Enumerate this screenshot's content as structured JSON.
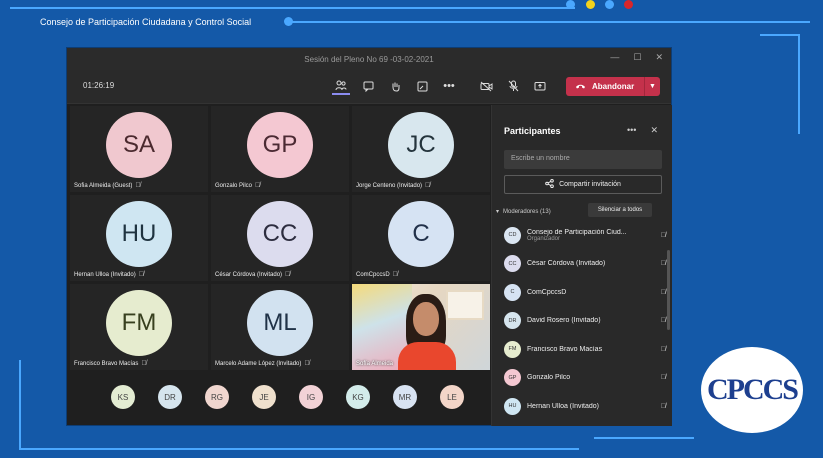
{
  "org_title": "Consejo de Participación Ciudadana y Control Social",
  "accent_colors": {
    "background": "#1459a8",
    "line": "#4aa8ff",
    "dot_yellow": "#f2d21c",
    "dot_red": "#d8262b",
    "dot_blue": "#4aa8ff",
    "leave": "#c4314b"
  },
  "window": {
    "title": "Sesión del Pleno No 69 -03-02-2021",
    "controls": [
      "—",
      "☐",
      "✕"
    ]
  },
  "toolbar": {
    "timer": "01:26:19",
    "leave_label": "Abandonar",
    "icons": [
      "participants-icon",
      "chat-icon",
      "raise-hand-icon",
      "share-tray-icon",
      "more-icon",
      "camera-off-icon",
      "mic-off-icon",
      "share-screen-icon"
    ]
  },
  "tiles": [
    {
      "initials": "SA",
      "name": "Sofia Almeida (Guest)",
      "color": "#f0c8cf"
    },
    {
      "initials": "GP",
      "name": "Gonzalo Pilco",
      "color": "#f4c8d2"
    },
    {
      "initials": "JC",
      "name": "Jorge Centeno (Invitado)",
      "color": "#d8e7ee"
    },
    {
      "initials": "HU",
      "name": "Hernan Ulloa (Invitado)",
      "color": "#cfe6f2"
    },
    {
      "initials": "CC",
      "name": "César Córdova (Invitado)",
      "color": "#dcdcee"
    },
    {
      "initials": "C",
      "name": "ComCpccsD",
      "color": "#d6e3f3"
    },
    {
      "initials": "FM",
      "name": "Francisco Bravo Macías",
      "color": "#e6eccf"
    },
    {
      "initials": "ML",
      "name": "Marcelo Adame López (Invitado)",
      "color": "#d2e2f0"
    },
    {
      "initials": "",
      "name": "Sofía Almeida",
      "color": ""
    }
  ],
  "strip": [
    {
      "initials": "KS",
      "color": "#e3ecd2"
    },
    {
      "initials": "DR",
      "color": "#d6e5ee"
    },
    {
      "initials": "RG",
      "color": "#f0d6cf"
    },
    {
      "initials": "JE",
      "color": "#efe0cd"
    },
    {
      "initials": "IG",
      "color": "#f2d2d6"
    },
    {
      "initials": "KG",
      "color": "#d3ecea"
    },
    {
      "initials": "MR",
      "color": "#d8e3f2"
    },
    {
      "initials": "LE",
      "color": "#f3d5c8"
    }
  ],
  "panel": {
    "title": "Participantes",
    "search_placeholder": "Escribe un nombre",
    "share_label": "Compartir invitación",
    "moderators_label": "Moderadores (13)",
    "mute_all_label": "Silenciar a todos",
    "participants": [
      {
        "initials": "CD",
        "name": "Consejo de Participación Ciud...",
        "role": "Organizador",
        "color": "#dbe6f2"
      },
      {
        "initials": "CC",
        "name": "César Córdova (Invitado)",
        "role": "",
        "color": "#dcdcee"
      },
      {
        "initials": "C",
        "name": "ComCpccsD",
        "role": "",
        "color": "#d6e3f3"
      },
      {
        "initials": "DR",
        "name": "David Rosero (Invitado)",
        "role": "",
        "color": "#d6e5ee"
      },
      {
        "initials": "FM",
        "name": "Francisco Bravo Macías",
        "role": "",
        "color": "#e6eccf"
      },
      {
        "initials": "GP",
        "name": "Gonzalo Pilco",
        "role": "",
        "color": "#f4c8d2"
      },
      {
        "initials": "HU",
        "name": "Hernan Ulloa (Invitado)",
        "role": "",
        "color": "#cfe6f2"
      }
    ]
  },
  "logo_text": "CPCCS"
}
